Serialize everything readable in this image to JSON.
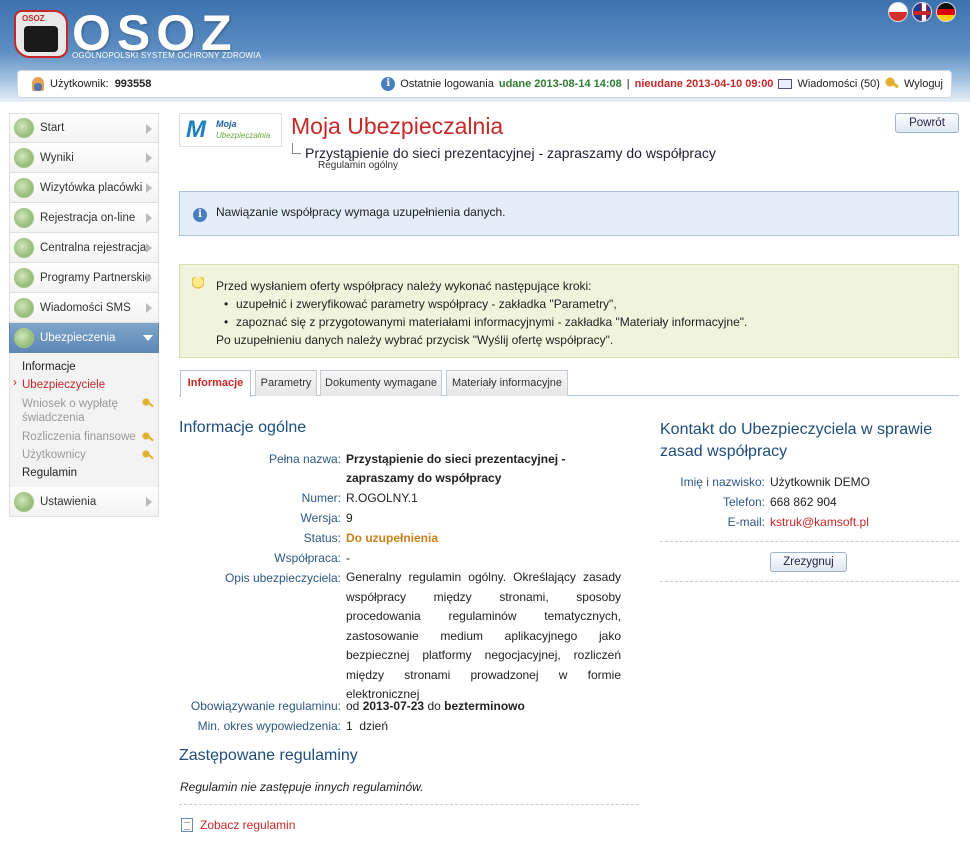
{
  "header": {
    "logo_text": "OSOZ",
    "logo_subtitle": "OGÓLNOPOLSKI SYSTEM OCHRONY ZDROWIA",
    "logo_mini": "OSOZ",
    "languages": [
      "PL",
      "EN",
      "DE"
    ]
  },
  "userbar": {
    "user_label": "Użytkownik:",
    "user_id": "993558",
    "last_login_label": "Ostatnie logowania",
    "success_label": "udane 2013-08-14 14:08",
    "separator": "|",
    "failed_label": "nieudane 2013-04-10 09:00",
    "messages_label": "Wiadomości (50)",
    "logout_label": "Wyloguj"
  },
  "sidebar": {
    "items": [
      {
        "label": "Start"
      },
      {
        "label": "Wyniki"
      },
      {
        "label": "Wizytówka placówki"
      },
      {
        "label": "Rejestracja on-line"
      },
      {
        "label": "Centralna rejestracja"
      },
      {
        "label": "Programy Partnerskie"
      },
      {
        "label": "Wiadomości SMS"
      },
      {
        "label": "Ubezpieczenia"
      },
      {
        "label": "Ustawienia"
      }
    ],
    "subitems": [
      {
        "label": "Informacje"
      },
      {
        "label": "Ubezpieczyciele"
      },
      {
        "label": "Wniosek o wypłatę świadczenia"
      },
      {
        "label": "Rozliczenia finansowe"
      },
      {
        "label": "Użytkownicy"
      },
      {
        "label": "Regulamin"
      }
    ]
  },
  "module": {
    "logo_m": "M",
    "logo_line1": "Moja",
    "logo_line2": "Ubezpieczalnia",
    "title": "Moja Ubezpieczalnia",
    "subtitle": "Przystąpienie do sieci prezentacyjnej - zapraszamy do współpracy",
    "subsubtitle": "Regulamin ogólny",
    "back_label": "Powrót"
  },
  "info_box": {
    "icon": "i",
    "text": "Nawiązanie współpracy wymaga uzupełnienia danych."
  },
  "tip_box": {
    "intro": "Przed wysłaniem oferty współpracy należy wykonać następujące kroki:",
    "bullets": [
      "uzupełnić i zweryfikować parametry współpracy - zakładka \"Parametry\",",
      "zapoznać się z przygotowanymi materiałami informacyjnymi - zakładka \"Materiały informacyjne\"."
    ],
    "outro": "Po uzupełnieniu danych należy wybrać przycisk \"Wyślij ofertę współpracy\"."
  },
  "tabs": [
    {
      "label": "Informacje"
    },
    {
      "label": "Parametry"
    },
    {
      "label": "Dokumenty wymagane"
    },
    {
      "label": "Materiały informacyjne"
    }
  ],
  "general": {
    "title": "Informacje ogólne",
    "full_name_label": "Pełna nazwa:",
    "full_name_line1": "Przystąpienie do sieci prezentacyjnej -",
    "full_name_line2": "zapraszamy do współpracy",
    "number_label": "Numer:",
    "number": "R.OGOLNY.1",
    "version_label": "Wersja:",
    "version": "9",
    "status_label": "Status:",
    "status": "Do uzupełnienia",
    "cooperation_label": "Współpraca:",
    "cooperation": "-",
    "desc_label": "Opis ubezpieczyciela:",
    "description": "Generalny regulamin ogólny. Określający zasady współpracy między stronami, sposoby procedowania regulaminów tematycznych, zastosowanie medium aplikacyjnego jako bezpiecznej platformy negocjacyjnej, rozliczeń między stronami prowadzonej w formie elektronicznej",
    "validity_label": "Obowiązywanie regulaminu:",
    "validity_prefix": "od",
    "validity_from": "2013-07-23",
    "validity_mid": "do",
    "validity_to": "bezterminowo",
    "notice_label": "Min. okres wypowiedzenia:",
    "notice": "1  dzień"
  },
  "replaced": {
    "title": "Zastępowane regulaminy",
    "text": "Regulamin nie zastępuje innych regulaminów.",
    "link": "Zobacz regulamin"
  },
  "contact": {
    "title_line1": "Kontakt do Ubezpieczyciela w sprawie",
    "title_line2": "zasad współpracy",
    "name_label": "Imię i nazwisko:",
    "name": "Użytkownik DEMO",
    "phone_label": "Telefon:",
    "phone": "668 862 904",
    "email_label": "E-mail:",
    "email": "kstruk@kamsoft.pl",
    "resign_label": "Zrezygnuj"
  }
}
